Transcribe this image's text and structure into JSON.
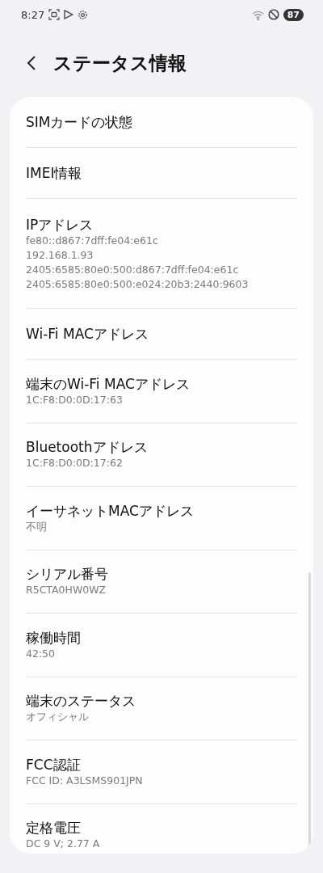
{
  "status_bar": {
    "time": "8:27",
    "battery": "87"
  },
  "header": {
    "title": "ステータス情報"
  },
  "items": [
    {
      "label": "SIMカードの状態"
    },
    {
      "label": "IMEI情報"
    },
    {
      "label": "IPアドレス",
      "values": [
        "fe80::d867:7dff:fe04:e61c",
        "192.168.1.93",
        "2405:6585:80e0:500:d867:7dff:fe04:e61c",
        "2405:6585:80e0:500:e024:20b3:2440:9603"
      ]
    },
    {
      "label": "Wi-Fi MACアドレス"
    },
    {
      "label": "端末のWi-Fi MACアドレス",
      "values": [
        "1C:F8:D0:0D:17:63"
      ]
    },
    {
      "label": "Bluetoothアドレス",
      "values": [
        "1C:F8:D0:0D:17:62"
      ]
    },
    {
      "label": "イーサネットMACアドレス",
      "values": [
        "不明"
      ]
    },
    {
      "label": "シリアル番号",
      "values": [
        "R5CTA0HW0WZ"
      ]
    },
    {
      "label": "稼働時間",
      "values": [
        "42:50"
      ]
    },
    {
      "label": "端末のステータス",
      "values": [
        "オフィシャル"
      ]
    },
    {
      "label": "FCC認証",
      "values": [
        "FCC ID: A3LSMS901JPN"
      ]
    },
    {
      "label": "定格電圧",
      "values": [
        "DC 9 V; 2.77 A"
      ]
    }
  ]
}
